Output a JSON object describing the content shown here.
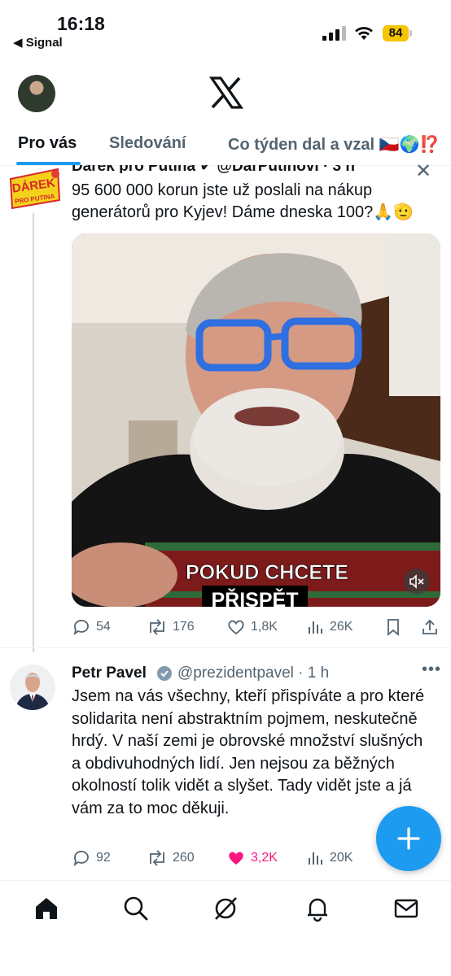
{
  "status_bar": {
    "time": "16:18",
    "back_app": "◀ Signal",
    "battery": "84",
    "battery_color": "#f5c400"
  },
  "header": {
    "logo_icon": "x-logo-icon"
  },
  "tabs": [
    {
      "label": "Pro vás",
      "active": true
    },
    {
      "label": "Sledování",
      "active": false
    },
    {
      "label": "Co týden dal a vzal 🇨🇿🌍⁉️",
      "active": false
    }
  ],
  "tweet1": {
    "logo_text_top": "DÁREK",
    "logo_text_bottom": "PRO PUTINA",
    "header": "Dárek pro Putina ✔ @DarPutinovi · 3 h",
    "text": "95 600 000 korun jste už poslali na nákup generátorů pro Kyjev! Dáme dneska 100?🙏🫡",
    "video_caption_line1": "POKUD CHCETE",
    "video_caption_line2": "PŘISPĚT",
    "actions": {
      "replies": "54",
      "reposts": "176",
      "likes": "1,8K",
      "views": "26K"
    }
  },
  "tweet2": {
    "name": "Petr Pavel",
    "handle": "@prezidentpavel · 1 h",
    "text": "Jsem na vás všechny, kteří přispíváte a pro které solidarita není abstraktním pojmem, neskutečně hrdý. V naší zemi je obrovské množství slušných a obdivuhodných lidí. Jen nejsou za běžných okolností tolik vidět a slyšet. Tady vidět jste a já vám za to moc děkuji.",
    "actions": {
      "replies": "92",
      "reposts": "260",
      "likes": "3,2K",
      "liked": true,
      "views": "20K"
    }
  },
  "colors": {
    "accent": "#1d9bf0",
    "like_active": "#f91880",
    "secondary_text": "#536471"
  },
  "bottom_nav": [
    "home-icon",
    "search-icon",
    "grok-icon",
    "notifications-icon",
    "messages-icon"
  ]
}
